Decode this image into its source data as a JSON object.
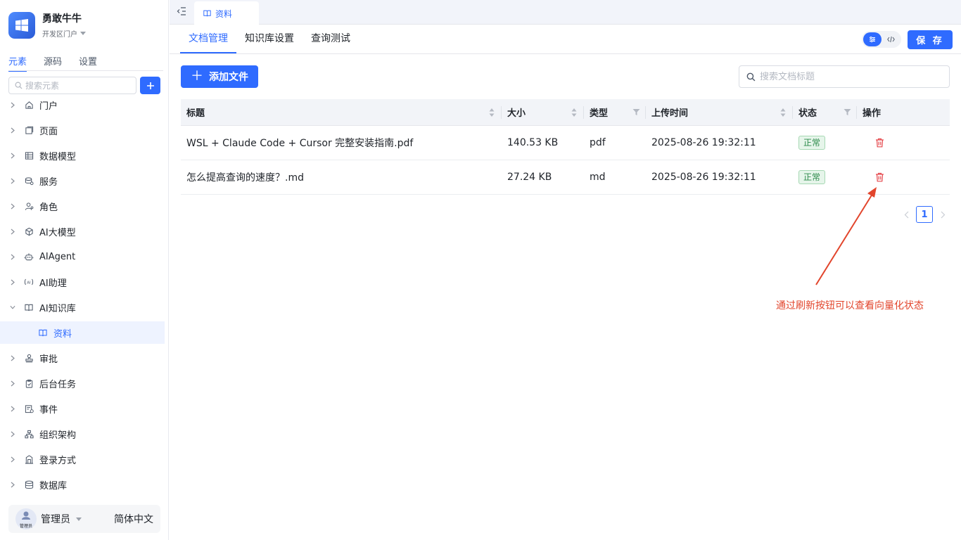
{
  "app": {
    "title": "勇敢牛牛",
    "portal": "开发区门户"
  },
  "sidebar": {
    "tabs": [
      {
        "label": "元素",
        "active": true
      },
      {
        "label": "源码",
        "active": false
      },
      {
        "label": "设置",
        "active": false
      }
    ],
    "search_placeholder": "搜索元素",
    "items": [
      {
        "label": "门户",
        "icon": "home-icon"
      },
      {
        "label": "页面",
        "icon": "page-icon"
      },
      {
        "label": "数据模型",
        "icon": "table-icon"
      },
      {
        "label": "服务",
        "icon": "service-icon"
      },
      {
        "label": "角色",
        "icon": "role-icon"
      },
      {
        "label": "AI大模型",
        "icon": "cube-icon"
      },
      {
        "label": "AIAgent",
        "icon": "robot-icon"
      },
      {
        "label": "AI助理",
        "icon": "ai-assistant-icon"
      },
      {
        "label": "AI知识库",
        "icon": "book-icon",
        "expanded": true
      },
      {
        "label": "资料",
        "icon": "book-icon",
        "child": true
      },
      {
        "label": "审批",
        "icon": "stamp-icon"
      },
      {
        "label": "后台任务",
        "icon": "task-icon"
      },
      {
        "label": "事件",
        "icon": "event-icon"
      },
      {
        "label": "组织架构",
        "icon": "org-icon"
      },
      {
        "label": "登录方式",
        "icon": "login-icon"
      },
      {
        "label": "数据库",
        "icon": "database-icon"
      }
    ],
    "footer": {
      "user": "管理员",
      "avatar_text": "管理员",
      "language": "简体中文"
    }
  },
  "topbar": {
    "tab_label": "资料"
  },
  "subtabs": [
    {
      "label": "文档管理",
      "active": true
    },
    {
      "label": "知识库设置",
      "active": false
    },
    {
      "label": "查询测试",
      "active": false
    }
  ],
  "header": {
    "save_label": "保 存"
  },
  "toolbar": {
    "add_file_label": "添加文件",
    "search_placeholder": "搜索文档标题"
  },
  "table": {
    "columns": [
      "标题",
      "大小",
      "类型",
      "上传时间",
      "状态",
      "操作"
    ],
    "rows": [
      {
        "title": "WSL + Claude Code + Cursor 完整安装指南.pdf",
        "size": "140.53 KB",
        "type": "pdf",
        "time": "2025-08-26 19:32:11",
        "status": "正常"
      },
      {
        "title": "怎么提高查询的速度？.md",
        "size": "27.24 KB",
        "type": "md",
        "time": "2025-08-26 19:32:11",
        "status": "正常"
      }
    ]
  },
  "pagination": {
    "current": "1"
  },
  "annotation": {
    "text": "通过刷新按钮可以查看向量化状态",
    "color": "#e2452c"
  },
  "colors": {
    "primary": "#2f6bff",
    "danger": "#e5484d",
    "success": "#2c8a4a"
  }
}
